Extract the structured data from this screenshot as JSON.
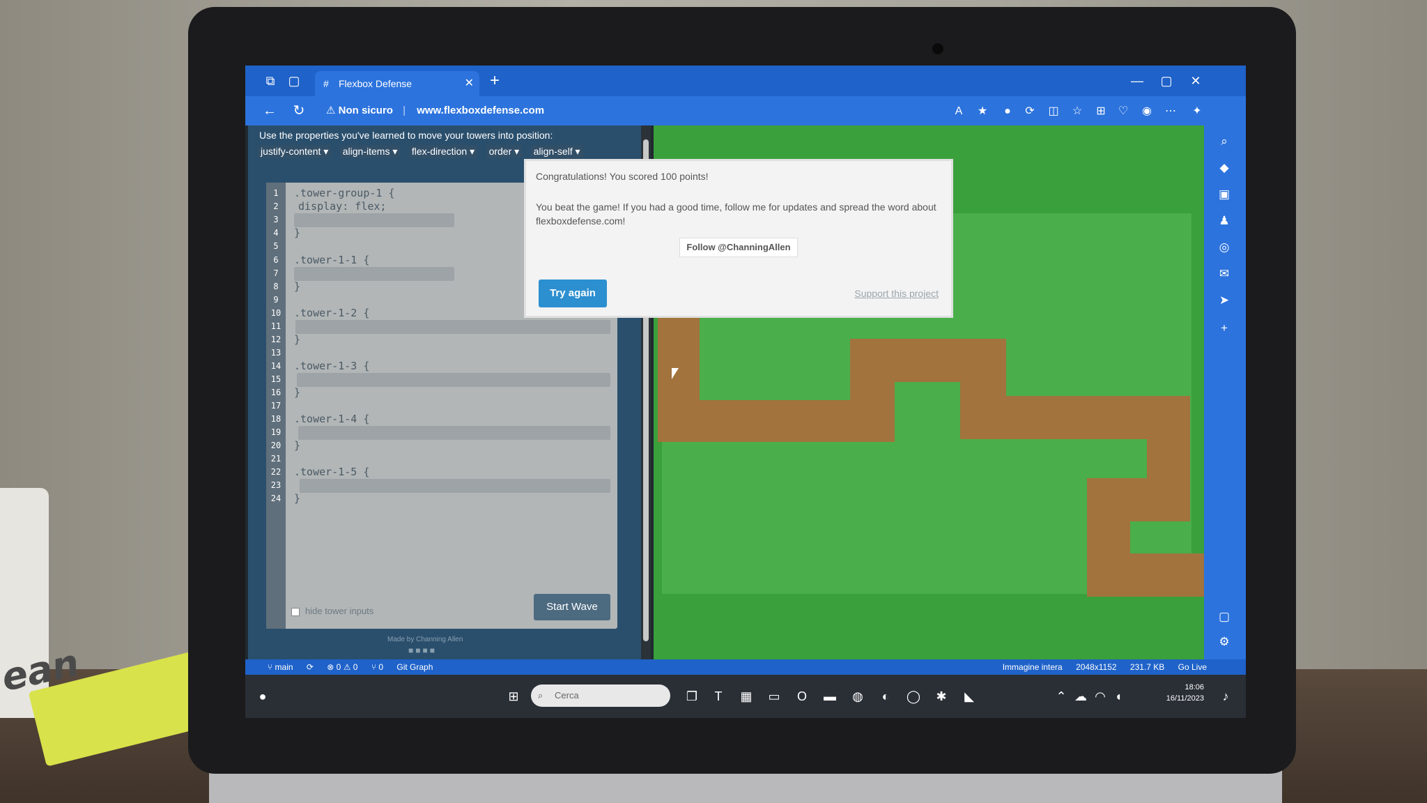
{
  "browser": {
    "tab_title": "Flexbox Defense",
    "new_tab": "+",
    "security_label": "Non sicuro",
    "url": "www.flexboxdefense.com"
  },
  "page": {
    "instructions": "Use the properties you've learned to move your towers into position:",
    "properties": [
      "justify-content ▾",
      "align-items ▾",
      "flex-direction ▾",
      "order ▾",
      "align-self ▾"
    ],
    "code_lines": [
      {
        "n": "1",
        "text": ".tower-group-1 {"
      },
      {
        "n": "2",
        "text": "  display: flex;"
      },
      {
        "n": "3",
        "text": ""
      },
      {
        "n": "4",
        "text": "}"
      },
      {
        "n": "5",
        "text": ""
      },
      {
        "n": "6",
        "text": ".tower-1-1 {"
      },
      {
        "n": "7",
        "text": ""
      },
      {
        "n": "8",
        "text": "}"
      },
      {
        "n": "9",
        "text": ""
      },
      {
        "n": "10",
        "text": ".tower-1-2 {"
      },
      {
        "n": "11",
        "text": ""
      },
      {
        "n": "12",
        "text": "}"
      },
      {
        "n": "13",
        "text": ""
      },
      {
        "n": "14",
        "text": ".tower-1-3 {"
      },
      {
        "n": "15",
        "text": ""
      },
      {
        "n": "16",
        "text": "}"
      },
      {
        "n": "17",
        "text": ""
      },
      {
        "n": "18",
        "text": ".tower-1-4 {"
      },
      {
        "n": "19",
        "text": ""
      },
      {
        "n": "20",
        "text": "}"
      },
      {
        "n": "21",
        "text": ""
      },
      {
        "n": "22",
        "text": ".tower-1-5 {"
      },
      {
        "n": "23",
        "text": ""
      },
      {
        "n": "24",
        "text": "}"
      }
    ],
    "hide_inputs_label": "hide tower inputs",
    "start_wave_label": "Start Wave",
    "credit": "Made by Channing Allen"
  },
  "modal": {
    "title": "Congratulations! You scored 100 points!",
    "body": "You beat the game! If you had a good time, follow me for updates and spread the word about flexboxdefense.com!",
    "follow_label": "Follow @ChanningAllen",
    "try_again_label": "Try again",
    "support_label": "Support this project"
  },
  "statusbar": {
    "branch": "main",
    "errors": "⊗ 0 ⚠ 0",
    "ports": "⑂ 0",
    "git_graph": "Git Graph",
    "image_label": "Immagine intera",
    "dimensions": "2048x1152",
    "size": "231.7 KB",
    "go_live": "Go Live"
  },
  "taskbar": {
    "search_placeholder": "Cerca",
    "time": "18:06",
    "date": "16/11/2023"
  },
  "photo": {
    "mug_text": "ean"
  },
  "colors": {
    "browser_blue": "#2c73dd",
    "game_green": "#3aa03b",
    "path_brown": "#a2733d",
    "try_again_blue": "#2c8fd0"
  },
  "icons": [
    "workspaces-icon",
    "tab-actions-icon",
    "back-arrow-icon",
    "refresh-icon",
    "warning-icon",
    "read-aloud-icon",
    "favorite-star-icon",
    "extensions-icon",
    "split-screen-icon",
    "collections-icon",
    "more-icon",
    "copilot-icon",
    "search-icon",
    "settings-icon",
    "windows-start-icon"
  ]
}
